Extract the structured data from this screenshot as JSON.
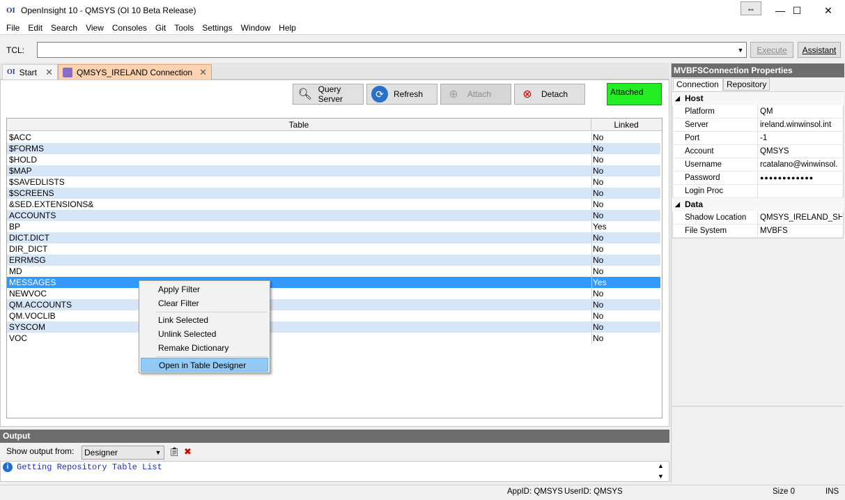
{
  "window": {
    "app_icon": "OI",
    "title": "OpenInsight 10 - QMSYS (OI 10 Beta Release)",
    "minimize": "—",
    "maximize": "☐",
    "close": "✕",
    "restore_arrows": "⇔"
  },
  "menu": [
    "File",
    "Edit",
    "Search",
    "View",
    "Consoles",
    "Git",
    "Tools",
    "Settings",
    "Window",
    "Help"
  ],
  "tcl": {
    "label": "TCL:",
    "value": "",
    "execute": "Execute",
    "assistant": "Assistant"
  },
  "tabs": [
    {
      "icon": "OI",
      "label": "Start",
      "close": "✕"
    },
    {
      "icon": "conn",
      "label": "QMSYS_IRELAND Connection",
      "close": "✕"
    }
  ],
  "toolbar": {
    "query_server": "Query Server",
    "refresh": "Refresh",
    "attach": "Attach",
    "detach": "Detach",
    "status": "Attached"
  },
  "grid": {
    "headers": [
      "Table",
      "Linked"
    ],
    "rows": [
      {
        "table": "$ACC",
        "linked": "No"
      },
      {
        "table": "$FORMS",
        "linked": "No"
      },
      {
        "table": "$HOLD",
        "linked": "No"
      },
      {
        "table": "$MAP",
        "linked": "No"
      },
      {
        "table": "$SAVEDLISTS",
        "linked": "No"
      },
      {
        "table": "$SCREENS",
        "linked": "No"
      },
      {
        "table": "&SED.EXTENSIONS&",
        "linked": "No"
      },
      {
        "table": "ACCOUNTS",
        "linked": "No"
      },
      {
        "table": "BP",
        "linked": "Yes"
      },
      {
        "table": "DICT.DICT",
        "linked": "No"
      },
      {
        "table": "DIR_DICT",
        "linked": "No"
      },
      {
        "table": "ERRMSG",
        "linked": "No"
      },
      {
        "table": "MD",
        "linked": "No"
      },
      {
        "table": "MESSAGES",
        "linked": "Yes"
      },
      {
        "table": "NEWVOC",
        "linked": "No"
      },
      {
        "table": "QM.ACCOUNTS",
        "linked": "No"
      },
      {
        "table": "QM.VOCLIB",
        "linked": "No"
      },
      {
        "table": "SYSCOM",
        "linked": "No"
      },
      {
        "table": "VOC",
        "linked": "No"
      }
    ]
  },
  "context_menu": {
    "apply_filter": "Apply Filter",
    "clear_filter": "Clear Filter",
    "link_selected": "Link Selected",
    "unlink_selected": "Unlink Selected",
    "remake_dictionary": "Remake Dictionary",
    "open_table_designer": "Open in Table Designer"
  },
  "properties": {
    "title": "MVBFSConnection Properties",
    "tabs": [
      "Connection",
      "Repository"
    ],
    "host_category": "Host",
    "host": [
      {
        "key": "Platform",
        "value": "QM"
      },
      {
        "key": "Server",
        "value": "ireland.winwinsol.int"
      },
      {
        "key": "Port",
        "value": "-1"
      },
      {
        "key": "Account",
        "value": "QMSYS"
      },
      {
        "key": "Username",
        "value": "rcatalano@winwinsol."
      },
      {
        "key": "Password",
        "value": "●●●●●●●●●●●●"
      },
      {
        "key": "Login Proc",
        "value": ""
      }
    ],
    "data_category": "Data",
    "data": [
      {
        "key": "Shadow Location",
        "value": "QMSYS_IRELAND_SHA"
      },
      {
        "key": "File System",
        "value": "MVBFS"
      }
    ]
  },
  "output": {
    "title": "Output",
    "show_from_label": "Show output from:",
    "source": "Designer",
    "message": "Getting Repository Table List"
  },
  "status": {
    "app_id": "AppID: QMSYS",
    "user_id": "UserID: QMSYS",
    "size": "Size 0",
    "mode": "INS"
  }
}
